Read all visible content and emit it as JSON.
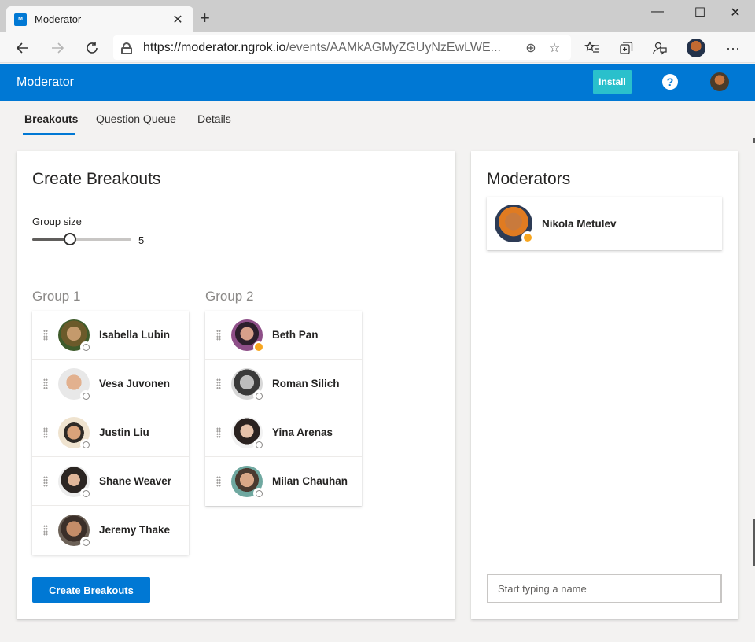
{
  "browser": {
    "tab_title": "Moderator",
    "favicon_text": "M",
    "url_host": "https://moderator.ngrok.io",
    "url_path": "/events/AAMkAGMyZGUyNzEwLWE...",
    "icons": {
      "back": "back-arrow-icon",
      "forward": "forward-arrow-icon",
      "refresh": "refresh-icon",
      "lock": "lock-icon",
      "add": "add-circle-icon",
      "favorite": "star-icon",
      "favorites": "favorites-icon",
      "collections": "collections-icon",
      "feedback": "feedback-icon",
      "more": "more-icon"
    }
  },
  "app": {
    "title": "Moderator",
    "install_label": "Install",
    "help_glyph": "?",
    "accent": "#0078d4",
    "install_color": "#2ac0cc"
  },
  "tabs": [
    {
      "label": "Breakouts",
      "active": true
    },
    {
      "label": "Question Queue",
      "active": false
    },
    {
      "label": "Details",
      "active": false
    }
  ],
  "breakouts": {
    "title": "Create Breakouts",
    "group_size_label": "Group size",
    "group_size_value": "5",
    "group_size_fraction": 0.38,
    "create_label": "Create Breakouts",
    "groups": [
      {
        "title": "Group 1",
        "members": [
          {
            "name": "Isabella Lubin",
            "status": "offline"
          },
          {
            "name": "Vesa Juvonen",
            "status": "offline"
          },
          {
            "name": "Justin Liu",
            "status": "offline"
          },
          {
            "name": "Shane Weaver",
            "status": "offline"
          },
          {
            "name": "Jeremy Thake",
            "status": "offline"
          }
        ]
      },
      {
        "title": "Group 2",
        "members": [
          {
            "name": "Beth Pan",
            "status": "away"
          },
          {
            "name": "Roman Silich",
            "status": "offline"
          },
          {
            "name": "Yina Arenas",
            "status": "offline"
          },
          {
            "name": "Milan Chauhan",
            "status": "offline"
          }
        ]
      }
    ]
  },
  "moderators": {
    "title": "Moderators",
    "list": [
      {
        "name": "Nikola Metulev",
        "status": "away"
      }
    ],
    "search_placeholder": "Start typing a name"
  }
}
